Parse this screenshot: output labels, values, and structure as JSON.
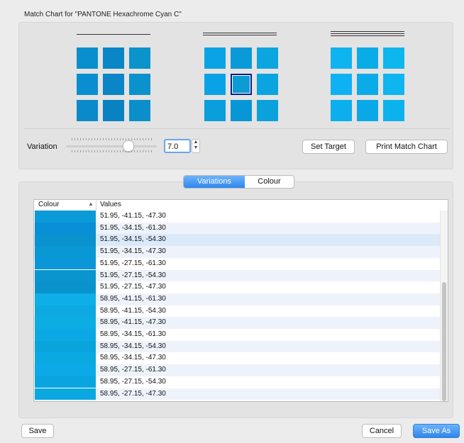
{
  "title": "Match Chart for \"PANTONE Hexachrome Cyan C\"",
  "charts": [
    {
      "swatches": [
        "#0a8fce",
        "#0986c6",
        "#0b93cb",
        "#0b8ed1",
        "#0985c8",
        "#0b92cc",
        "#0a8acb",
        "#0982c3",
        "#0b8fca"
      ]
    },
    {
      "swatches": [
        "#0aa3e4",
        "#0a9ad9",
        "#0ba6e0",
        "#0aa2e6",
        "#0d9bd4",
        "#0aa5e0",
        "#0a9edd",
        "#0896d6",
        "#0aa1dc"
      ]
    },
    {
      "swatches": [
        "#0fb3f0",
        "#0aace8",
        "#0eb6ee",
        "#0eb2f3",
        "#0aabe8",
        "#0fb5ef",
        "#0caeed",
        "#09a8e6",
        "#0cb2ec"
      ]
    }
  ],
  "variation": {
    "label": "Variation",
    "value": "7.0"
  },
  "buttons": {
    "set_target": "Set Target",
    "print": "Print Match Chart",
    "save": "Save",
    "cancel": "Cancel",
    "save_as": "Save As"
  },
  "tabs": [
    "Variations",
    "Colour"
  ],
  "table": {
    "col_colour": "Colour",
    "col_values": "Values",
    "rows": [
      {
        "color": "#0a9ad8",
        "values": "51.95, -41.15, -47.30"
      },
      {
        "color": "#088fd5",
        "values": "51.95, -34.15, -61.30"
      },
      {
        "color": "#0992cd",
        "values": "51.95, -34.15, -54.30"
      },
      {
        "color": "#0a98d4",
        "values": "51.95, -34.15, -47.30"
      },
      {
        "color": "#0a96d8",
        "values": "51.95, -27.15, -61.30"
      },
      {
        "color": "#0a95cf",
        "values": "51.95, -27.15, -54.30"
      },
      {
        "color": "#0a92cc",
        "values": "51.95, -27.15, -47.30"
      },
      {
        "color": "#0eaee8",
        "values": "58.95, -41.15, -61.30"
      },
      {
        "color": "#0da9e3",
        "values": "58.95, -41.15, -54.30"
      },
      {
        "color": "#0cade2",
        "values": "58.95, -41.15, -47.30"
      },
      {
        "color": "#0ba8e6",
        "values": "58.95, -34.15, -61.30"
      },
      {
        "color": "#0aa4dd",
        "values": "58.95, -34.15, -54.30"
      },
      {
        "color": "#0ba9e2",
        "values": "58.95, -34.15, -47.30"
      },
      {
        "color": "#0ba9e8",
        "values": "58.95, -27.15, -61.30"
      },
      {
        "color": "#0aa5e0",
        "values": "58.95, -27.15, -54.30"
      },
      {
        "color": "#0aa8e0",
        "values": "58.95, -27.15, -47.30"
      }
    ],
    "selected_index": 2
  },
  "colors": {
    "accent": "#2f86ee",
    "selected_row": "#dce9f9",
    "alt_row": "#eef3fb"
  }
}
